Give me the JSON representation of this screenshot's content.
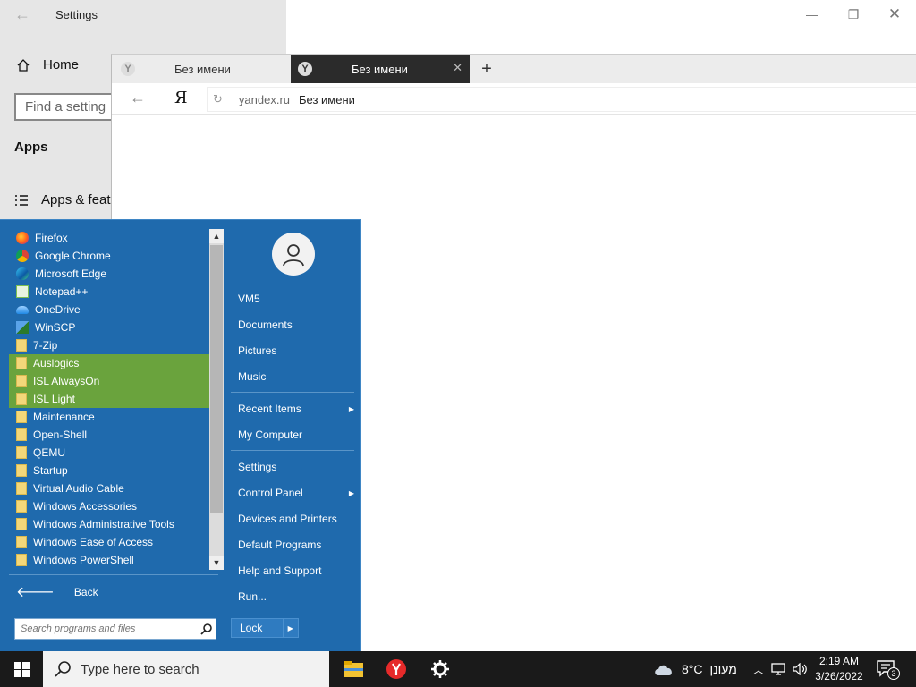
{
  "settings": {
    "title": "Settings",
    "home": "Home",
    "find_placeholder": "Find a setting",
    "section": "Apps",
    "apps_features": "Apps & featu"
  },
  "browser": {
    "tabs": [
      {
        "title": "Без имени",
        "active": false
      },
      {
        "title": "Без имени",
        "active": true
      }
    ],
    "logo": "Я",
    "domain": "yandex.ru",
    "page_title": "Без имени"
  },
  "start_menu": {
    "programs": [
      {
        "label": "Firefox",
        "icon": "firefox-icon"
      },
      {
        "label": "Google Chrome",
        "icon": "chrome-icon"
      },
      {
        "label": "Microsoft Edge",
        "icon": "edge-icon"
      },
      {
        "label": "Notepad++",
        "icon": "notepad-icon"
      },
      {
        "label": "OneDrive",
        "icon": "onedrive-icon"
      },
      {
        "label": "WinSCP",
        "icon": "winscp-icon"
      },
      {
        "label": "7-Zip",
        "icon": "folder-icon"
      },
      {
        "label": "Auslogics",
        "icon": "folder-icon",
        "highlight": true
      },
      {
        "label": "ISL AlwaysOn",
        "icon": "folder-icon",
        "highlight": true
      },
      {
        "label": "ISL Light",
        "icon": "folder-icon",
        "highlight": true
      },
      {
        "label": "Maintenance",
        "icon": "folder-icon"
      },
      {
        "label": "Open-Shell",
        "icon": "folder-icon"
      },
      {
        "label": "QEMU",
        "icon": "folder-icon"
      },
      {
        "label": "Startup",
        "icon": "folder-icon"
      },
      {
        "label": "Virtual Audio Cable",
        "icon": "folder-icon"
      },
      {
        "label": "Windows Accessories",
        "icon": "folder-icon"
      },
      {
        "label": "Windows Administrative Tools",
        "icon": "folder-icon"
      },
      {
        "label": "Windows Ease of Access",
        "icon": "folder-icon"
      },
      {
        "label": "Windows PowerShell",
        "icon": "folder-icon"
      }
    ],
    "back": "Back",
    "search_placeholder": "Search programs and files",
    "user": "VM5",
    "links": {
      "documents": "Documents",
      "pictures": "Pictures",
      "music": "Music",
      "recent_items": "Recent Items",
      "my_computer": "My Computer",
      "settings": "Settings",
      "control_panel": "Control Panel",
      "devices_printers": "Devices and Printers",
      "default_programs": "Default Programs",
      "help_support": "Help and Support",
      "run": "Run..."
    },
    "lock": "Lock"
  },
  "taskbar": {
    "search_placeholder": "Type here to search",
    "weather_temp": "8°C",
    "weather_desc": "מעונן",
    "time": "2:19 AM",
    "date": "3/26/2022",
    "notification_count": "3"
  },
  "colors": {
    "start_bg": "#1f6aad",
    "highlight": "#6aa33d",
    "taskbar_bg": "#1a1a1a"
  }
}
